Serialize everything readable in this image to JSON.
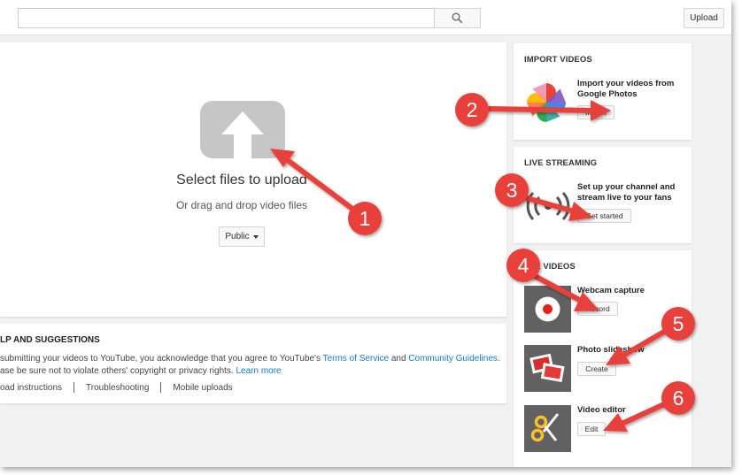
{
  "topbar": {
    "search_placeholder": "",
    "search_icon": "search-icon",
    "upload_label": "Upload"
  },
  "upload": {
    "icon": "upload-arrow-icon",
    "title": "Select files to upload",
    "subtitle": "Or drag and drop video files",
    "privacy_value": "Public"
  },
  "help": {
    "title": "LP AND SUGGESTIONS",
    "line1_prefix": "submitting your videos to YouTube, you acknowledge that you agree to YouTube's ",
    "terms_link": "Terms of Service",
    "line1_and": " and ",
    "guidelines_link": "Community Guidelines",
    "line1_suffix": ".",
    "line2_prefix": "ase be sure not to violate others' copyright or privacy rights. ",
    "learn_more_link": "Learn more",
    "links": [
      "oad instructions",
      "Troubleshooting",
      "Mobile uploads"
    ]
  },
  "import": {
    "title": "IMPORT VIDEOS",
    "description": "Import your videos from Google Photos",
    "button": "Import",
    "icon": "google-photos-icon"
  },
  "live": {
    "title": "LIVE STREAMING",
    "description": "Set up your channel and stream live to your fans",
    "button": "Get started",
    "icon": "broadcast-icon"
  },
  "create": {
    "title": "ATE VIDEOS",
    "items": [
      {
        "label": "Webcam capture",
        "button": "Record",
        "icon": "record-icon"
      },
      {
        "label": "Photo slideshow",
        "button": "Create",
        "icon": "photos-icon"
      },
      {
        "label": "Video editor",
        "button": "Edit",
        "icon": "scissors-icon"
      }
    ]
  },
  "annotations": [
    "1",
    "2",
    "3",
    "4",
    "5",
    "6"
  ],
  "colors": {
    "annotation_red": "#e8413a",
    "link_blue": "#167ac6",
    "background": "#f1f1f1"
  }
}
